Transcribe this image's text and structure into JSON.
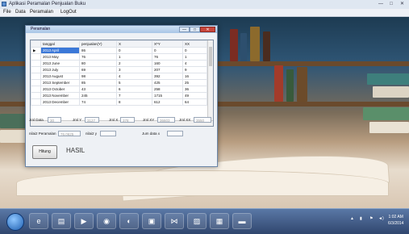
{
  "app": {
    "title": "Aplikasi Peramalan Penjualan Buku"
  },
  "menu": [
    "File",
    "Data",
    "Peramalan",
    "LogOut"
  ],
  "dialog": {
    "title": "Peramalan"
  },
  "grid": {
    "columns": [
      "",
      "tanggal",
      "penjualan(Y)",
      "X",
      "X*Y",
      "XX"
    ],
    "rows": [
      {
        "marker": "▶",
        "cells": [
          "2013 April",
          "86",
          "0",
          "0",
          "0"
        ]
      },
      {
        "marker": "",
        "cells": [
          "2013 May",
          "76",
          "1",
          "76",
          "1"
        ]
      },
      {
        "marker": "",
        "cells": [
          "2013 June",
          "80",
          "2",
          "160",
          "4"
        ]
      },
      {
        "marker": "",
        "cells": [
          "2013 July",
          "69",
          "3",
          "207",
          "9"
        ]
      },
      {
        "marker": "",
        "cells": [
          "2013 August",
          "98",
          "4",
          "392",
          "16"
        ]
      },
      {
        "marker": "",
        "cells": [
          "2013 September",
          "85",
          "5",
          "425",
          "25"
        ]
      },
      {
        "marker": "",
        "cells": [
          "2013 October",
          "43",
          "6",
          "258",
          "36"
        ]
      },
      {
        "marker": "",
        "cells": [
          "2013 November",
          "245",
          "7",
          "1715",
          "49"
        ]
      },
      {
        "marker": "",
        "cells": [
          "2013 December",
          "74",
          "8",
          "612",
          "64"
        ]
      }
    ]
  },
  "fields": {
    "jml_data": {
      "label": "Jml Data",
      "value": "30"
    },
    "jml_y": {
      "label": "Jml Y",
      "value": "3127"
    },
    "jml_x": {
      "label": "Jml X",
      "value": "378"
    },
    "jml_xy": {
      "label": "Jml XY",
      "value": "36603"
    },
    "jml_xx": {
      "label": "Jml XX",
      "value": "3550"
    },
    "nilai_peramalan": {
      "label": "nilai2 Peramalan",
      "value": "76.0625"
    },
    "nilai_y": {
      "label": "nilai2 y",
      "value": ""
    },
    "jum_data_x": {
      "label": "Jum data x",
      "value": ""
    }
  },
  "buttons": {
    "hitung": "Hitung"
  },
  "hasil_label": "HASIL",
  "taskbar": {
    "clock_time": "1:02 AM",
    "clock_date": "6/3/2014",
    "tray_arrow": "▲",
    "icons": [
      "ie-icon",
      "explorer-icon",
      "media-icon",
      "chrome-icon",
      "firefox-icon",
      "app-icon",
      "vs-icon",
      "paint-icon",
      "window-icon",
      "folder-icon"
    ]
  },
  "colors": {
    "selection": "#3b78d8",
    "taskbar": "#30466e",
    "dialog_title": "#a9c5e6"
  }
}
